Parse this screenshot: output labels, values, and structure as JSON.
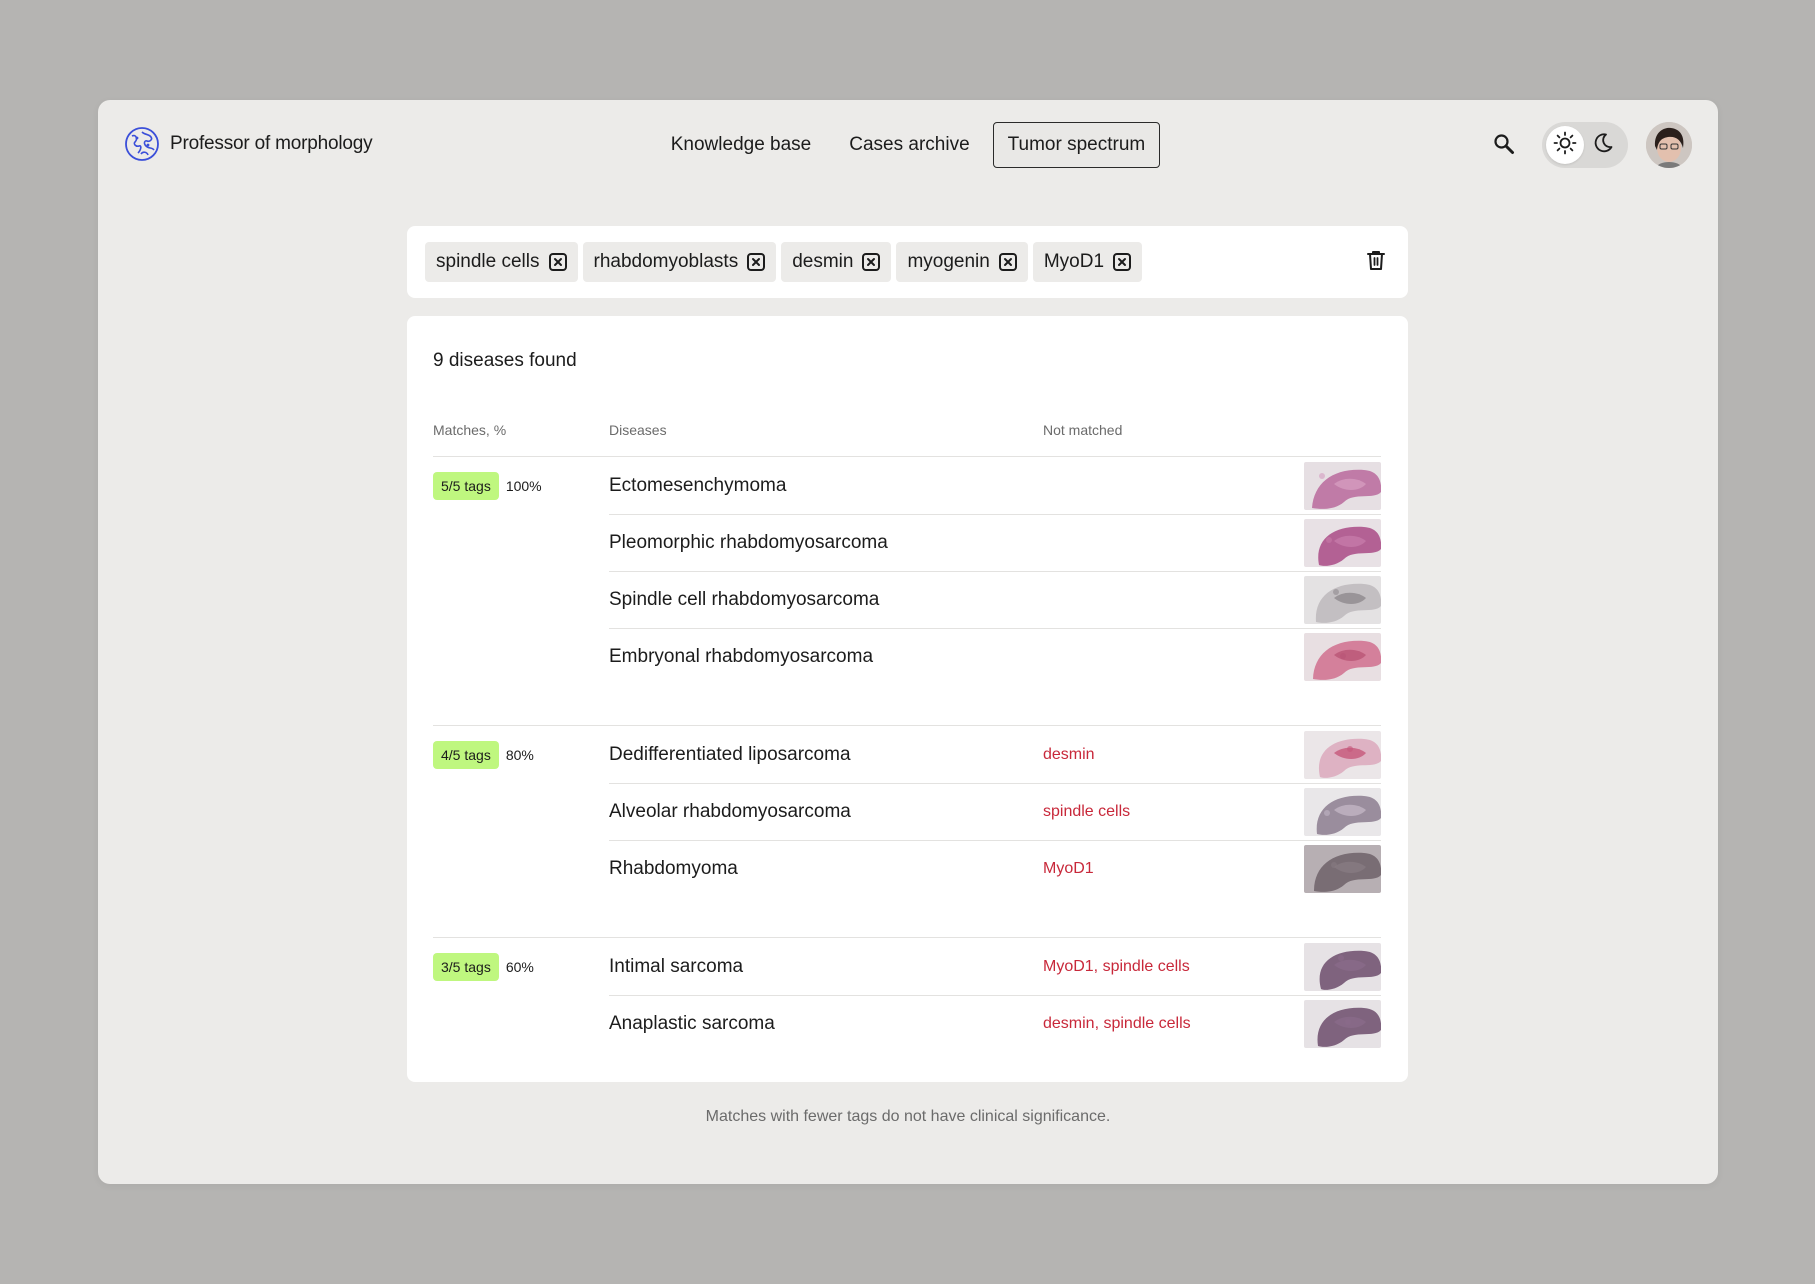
{
  "header": {
    "brand": "Professor of morphology",
    "nav": [
      "Knowledge base",
      "Cases archive",
      "Tumor spectrum"
    ],
    "active_nav": 2
  },
  "filters": {
    "tags": [
      "spindle cells",
      "rhabdomyoblasts",
      "desmin",
      "myogenin",
      "MyoD1"
    ]
  },
  "results": {
    "title": "9 diseases found",
    "columns": {
      "matches": "Matches, %",
      "diseases": "Diseases",
      "not_matched": "Not matched"
    },
    "groups": [
      {
        "badge": "5/5 tags",
        "percent": "100%",
        "rows": [
          {
            "name": "Ectomesenchymoma",
            "not_matched": "",
            "thumb": "pink"
          },
          {
            "name": "Pleomorphic rhabdomyosarcoma",
            "not_matched": "",
            "thumb": "magenta"
          },
          {
            "name": "Spindle cell rhabdomyosarcoma",
            "not_matched": "",
            "thumb": "grey"
          },
          {
            "name": "Embryonal rhabdomyosarcoma",
            "not_matched": "",
            "thumb": "rose"
          }
        ]
      },
      {
        "badge": "4/5 tags",
        "percent": "80%",
        "rows": [
          {
            "name": "Dedifferentiated liposarcoma",
            "not_matched": "desmin",
            "thumb": "pale-pink"
          },
          {
            "name": "Alveolar rhabdomyosarcoma",
            "not_matched": "spindle cells",
            "thumb": "lilac"
          },
          {
            "name": "Rhabdomyoma",
            "not_matched": "MyoD1",
            "thumb": "dark"
          }
        ]
      },
      {
        "badge": "3/5 tags",
        "percent": "60%",
        "rows": [
          {
            "name": "Intimal sarcoma",
            "not_matched": "MyoD1, spindle cells",
            "thumb": "purple"
          },
          {
            "name": "Anaplastic sarcoma",
            "not_matched": "desmin, spindle cells",
            "thumb": "purple"
          }
        ]
      }
    ]
  },
  "footnote": "Matches with fewer tags do not have clinical significance.",
  "colors": {
    "badge": "#bff77f",
    "not_matched_text": "#c8283a",
    "brand_icon": "#3b4fd9",
    "window_bg": "#ecebe9"
  },
  "icons": [
    "logo-globe-icon",
    "search-icon",
    "sun-icon",
    "moon-icon",
    "tag-close-icon",
    "trash-icon"
  ]
}
